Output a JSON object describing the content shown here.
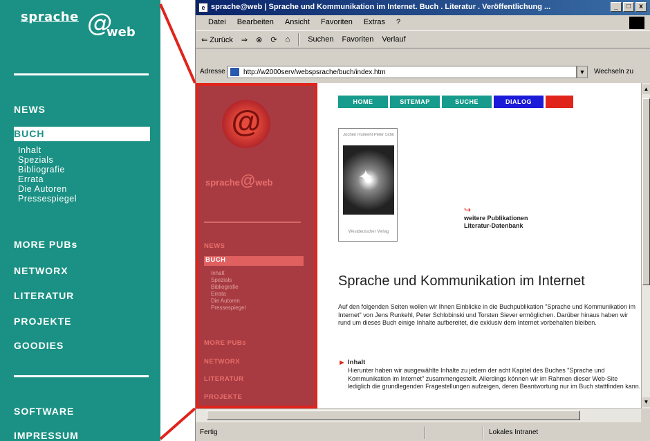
{
  "site": {
    "logo_word1": "sprache",
    "logo_at": "@",
    "logo_word2": "web",
    "nav": {
      "news": "NEWS",
      "buch": "BUCH",
      "sub": [
        "Inhalt",
        "Spezials",
        "Bibliografie",
        "Errata",
        "Die Autoren",
        "Pressespiegel"
      ],
      "more_pubs": "MORE PUBs",
      "networx": "NETWORX",
      "literatur": "LITERATUR",
      "projekte": "PROJEKTE",
      "goodies": "GOODIES",
      "software": "SOFTWARE",
      "impressum": "IMPRESSUM"
    }
  },
  "browser": {
    "title": "sprache@web | Sprache und Kommunikation im Internet. Buch . Literatur . Veröffentlichung ...",
    "title_buttons": [
      "_",
      "□",
      "x"
    ],
    "menu": [
      "Datei",
      "Bearbeiten",
      "Ansicht",
      "Favoriten",
      "Extras",
      "?"
    ],
    "toolbar": {
      "back": "⇐ Zurück",
      "forward": "⇒",
      "stop": "⊗",
      "refresh": "⟳",
      "home": "⌂",
      "search": "Suchen",
      "favorites": "Favoriten",
      "history": "Verlauf"
    },
    "address_label": "Adresse",
    "address_value": "http://w2000serv/webspsrache/buch/index.htm",
    "go_label": "Wechseln zu",
    "status_left": "Fertig",
    "status_zone": "Lokales Intranet"
  },
  "content": {
    "red_logo_word1": "sprache",
    "red_logo_at": "@",
    "red_logo_word2": "web",
    "red_nav": {
      "news": "NEWS",
      "buch": "BUCH",
      "sub": [
        "Inhalt",
        "Spezials",
        "Bibliografie",
        "Errata",
        "Die Autoren",
        "Pressespiegel"
      ],
      "more_pubs": "MORE PUBs",
      "networx": "NETWORX",
      "literatur": "LITERATUR",
      "projekte": "PROJEKTE"
    },
    "topnav": [
      {
        "label": "HOME",
        "color": "#169b8c"
      },
      {
        "label": "SITEMAP",
        "color": "#169b8c"
      },
      {
        "label": "SUCHE",
        "color": "#169b8c"
      },
      {
        "label": "DIALOG",
        "color": "#1a1ad8"
      },
      {
        "label": "",
        "color": "#e0241c"
      }
    ],
    "book_head": "Jochen Runkehl  Peter Schlobinski  Torsten Siever",
    "book_foot": "Westdeutscher Verlag",
    "pub_line1": "weitere Publikationen",
    "pub_line2": "Literatur-Datenbank",
    "heading": "Sprache und Kommunikation im Internet",
    "para": "Auf den folgenden Seiten wollen wir Ihnen Einblicke in die Buchpublikation \"Sprache und Kommunikation im Internet\" von Jens Runkehl, Peter Schlobinski und Torsten Siever ermöglichen. Darüber hinaus haben wir rund um dieses Buch einige Inhalte aufbereitet, die exklusiv dem Internet vorbehalten bleiben.",
    "inhalt_title": "Inhalt",
    "inhalt_text": "Hierunter haben wir ausgewählte Inhalte zu jedem der acht Kapitel des Buches \"Sprache und Kommunikation im Internet\" zusammengestellt. Allerdings können wir im Rahmen dieser Web-Site lediglich die grundlegenden Fragestellungen aufzeigen, deren Beantwortung nur im Buch stattfinden kann."
  },
  "colors": {
    "teal": "#1a9184",
    "red_panel": "#a83b42",
    "callout": "#e0241c"
  }
}
